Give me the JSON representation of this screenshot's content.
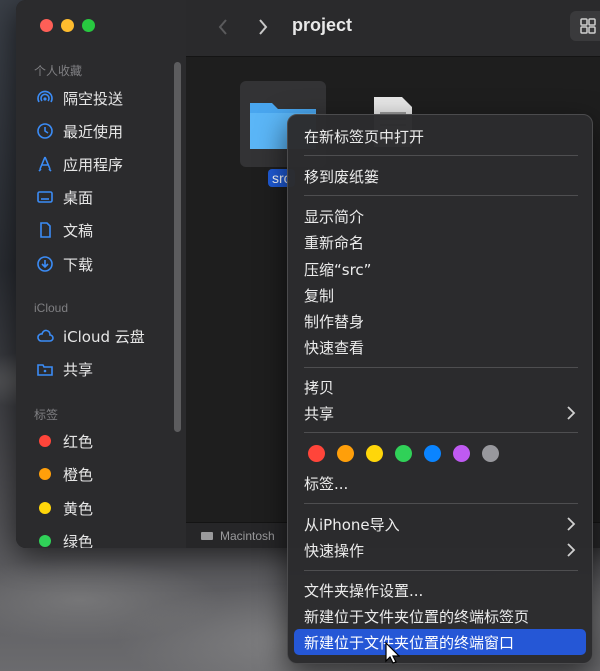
{
  "window": {
    "title": "project"
  },
  "sidebar": {
    "favorites_title": "个人收藏",
    "favorites": [
      {
        "label": "隔空投送",
        "icon": "airdrop-icon"
      },
      {
        "label": "最近使用",
        "icon": "clock-icon"
      },
      {
        "label": "应用程序",
        "icon": "applications-icon"
      },
      {
        "label": "桌面",
        "icon": "desktop-icon"
      },
      {
        "label": "文稿",
        "icon": "document-icon"
      },
      {
        "label": "下载",
        "icon": "download-icon"
      }
    ],
    "icloud_title": "iCloud",
    "icloud": [
      {
        "label": "iCloud 云盘",
        "icon": "cloud-icon"
      },
      {
        "label": "共享",
        "icon": "shared-folder-icon"
      }
    ],
    "tags_title": "标签",
    "tags": [
      {
        "label": "红色",
        "color": "#ff453a"
      },
      {
        "label": "橙色",
        "color": "#ff9f0a"
      },
      {
        "label": "黄色",
        "color": "#ffd60a"
      },
      {
        "label": "绿色",
        "color": "#30d158"
      }
    ]
  },
  "content": {
    "selected_file_label": "src",
    "pathbar_text": "Macintosh"
  },
  "context_menu": {
    "items": [
      "在新标签页中打开",
      "移到废纸篓",
      "显示简介",
      "重新命名",
      "压缩“src”",
      "复制",
      "制作替身",
      "快速查看",
      "拷贝",
      "共享",
      "标签...",
      "从iPhone导入",
      "快速操作",
      "文件夹操作设置...",
      "新建位于文件夹位置的终端标签页",
      "新建位于文件夹位置的终端窗口"
    ],
    "tag_colors": [
      "#ff453a",
      "#ff9f0a",
      "#ffd60a",
      "#30d158",
      "#0a84ff",
      "#bf5af2",
      "#98989d"
    ],
    "highlighted_index": 15
  }
}
